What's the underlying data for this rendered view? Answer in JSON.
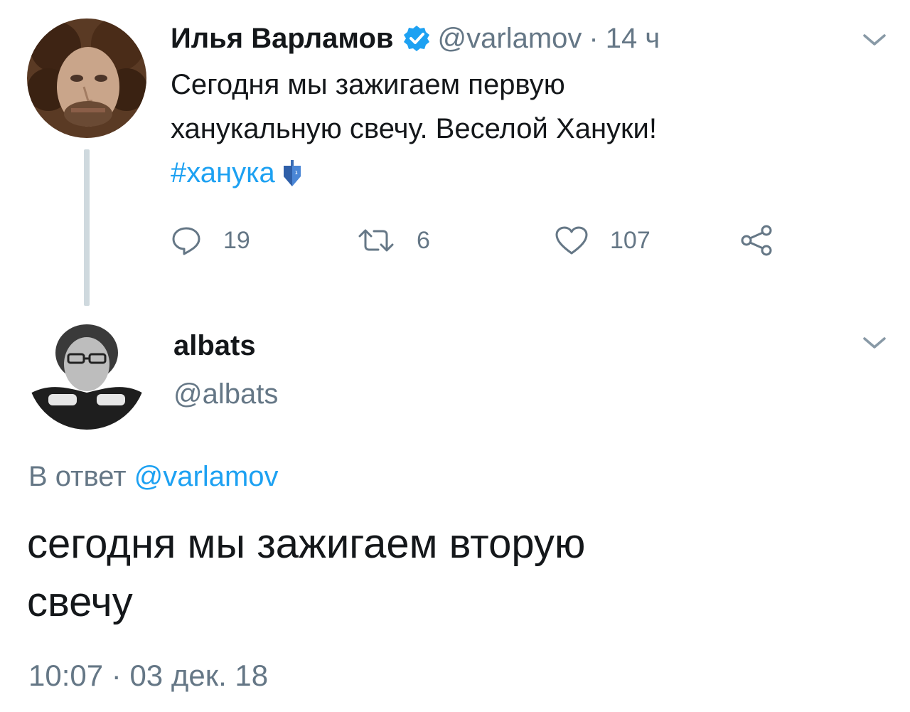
{
  "tweet": {
    "author_name": "Илья Варламов",
    "author_handle": "@varlamov",
    "separator": "·",
    "time_ago": "14 ч",
    "text_line1": "Сегодня мы зажигаем первую",
    "text_line2": "ханукальную свечу. Веселой Хануки!",
    "hashtag": "#ханука",
    "verified_icon": "verified-badge-icon",
    "actions": {
      "reply_count": "19",
      "retweet_count": "6",
      "like_count": "107"
    }
  },
  "reply": {
    "author_name": "albats",
    "author_handle": "@albats",
    "reply_prefix": "В ответ",
    "reply_mention": "@varlamov",
    "text_line1": "сегодня мы зажигаем вторую",
    "text_line2": "свечу",
    "time": "10:07",
    "separator": "·",
    "date": "03 дек. 18"
  },
  "colors": {
    "accent": "#1da1f2",
    "muted": "#657786",
    "text": "#14171a",
    "thread_line": "#cfd9de"
  }
}
